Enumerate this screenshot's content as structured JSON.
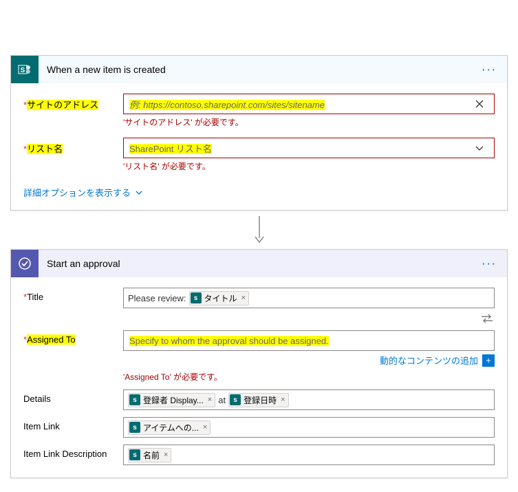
{
  "trigger": {
    "title": "When a new item is created",
    "menu": "···",
    "siteAddress": {
      "label": "サイトのアドレス",
      "placeholder": "例: https://contoso.sharepoint.com/sites/sitename",
      "error": "'サイトのアドレス' が必要です。"
    },
    "listName": {
      "label": "リスト名",
      "placeholder": "SharePoint リスト名",
      "error": "'リスト名' が必要です。"
    },
    "advanced": "詳細オプションを表示する"
  },
  "action": {
    "title": "Start an approval",
    "menu": "···",
    "titleField": {
      "label": "Title",
      "prefix": "Please review:",
      "token": "タイトル"
    },
    "assignedTo": {
      "label": "Assigned To",
      "placeholder": "Specify to whom the approval should be assigned.",
      "error": "'Assigned To' が必要です。"
    },
    "dynamic": "動的なコンテンツの追加",
    "details": {
      "label": "Details",
      "token1": "登録者 Display...",
      "mid": "at",
      "token2": "登録日時"
    },
    "itemLink": {
      "label": "Item Link",
      "token": "アイテムへの..."
    },
    "itemLinkDesc": {
      "label": "Item Link Description",
      "token": "名前"
    }
  }
}
